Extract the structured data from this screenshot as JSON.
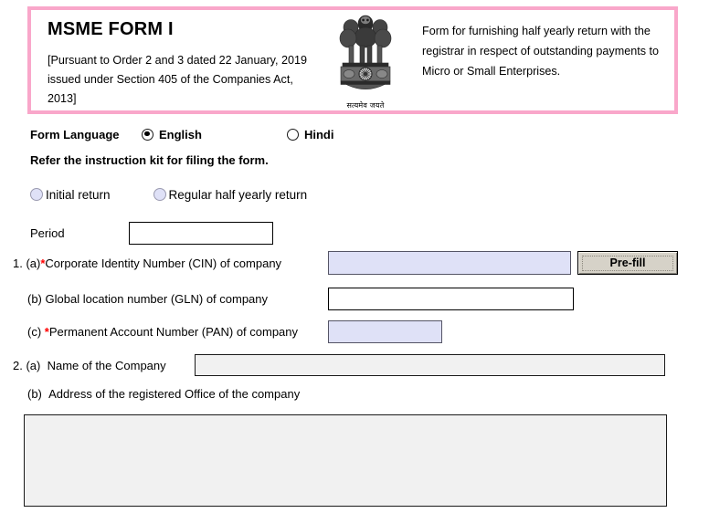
{
  "header": {
    "title": "MSME FORM I",
    "subtitle": "[Pursuant to Order 2 and 3 dated 22 January, 2019 issued   under Section 405 of the Companies Act, 2013]",
    "emblem_name": "india-national-emblem",
    "emblem_motto": "सत्यमेव जयते",
    "purpose_text": "Form for furnishing half yearly return with the registrar in respect of outstanding payments to Micro or Small Enterprises.",
    "border_color": "#f9a7ca"
  },
  "language": {
    "label": "Form Language",
    "options": [
      {
        "label": "English",
        "selected": true
      },
      {
        "label": "Hindi",
        "selected": false
      }
    ]
  },
  "instruction": "Refer the instruction kit for filing the form.",
  "return_type": {
    "options": [
      {
        "label": "Initial return",
        "selected": false
      },
      {
        "label": "Regular half yearly return",
        "selected": false
      }
    ]
  },
  "period": {
    "label": "Period",
    "value": "",
    "placeholder": ""
  },
  "fields": {
    "cin": {
      "number": "1. (a)",
      "required": true,
      "star": "*",
      "label": "Corporate Identity Number (CIN) of company",
      "value": "",
      "mandatory_fill": "#dfe1f7"
    },
    "gln": {
      "number": "(b)",
      "required": false,
      "label": "Global location number (GLN) of company",
      "value": ""
    },
    "pan": {
      "number": "(c)",
      "required": true,
      "star": "*",
      "label": "Permanent Account Number (PAN) of company",
      "value": ""
    },
    "company_name": {
      "number": "2. (a)",
      "required": false,
      "label": "Name of the Company",
      "value": "",
      "readonly": true
    },
    "registered_address": {
      "number": "(b)",
      "label": "Address of the registered Office of the company",
      "value": "",
      "readonly": true
    }
  },
  "buttons": {
    "prefill": "Pre-fill"
  },
  "colors": {
    "mandatory_field": "#dfe1f7",
    "readonly_field": "#f1f1f1",
    "required_star": "#ff0000",
    "banner_border": "#f9a7ca",
    "button_face": "#d6d2c8"
  }
}
